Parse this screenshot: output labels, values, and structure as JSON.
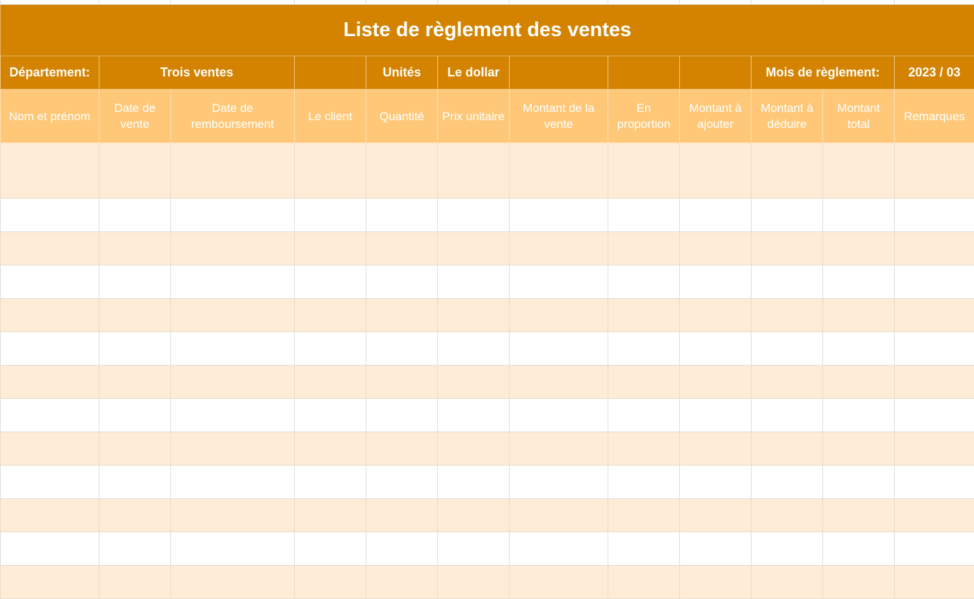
{
  "sheet": {
    "title": "Liste de règlement des ventes",
    "info": {
      "department_label": "Département:",
      "department_value": "Trois ventes",
      "units_label": "Unités",
      "units_value": "Le dollar",
      "month_label": "Mois de règlement:",
      "month_value": "2023 / 03"
    },
    "columns": [
      "Nom et prénom",
      "Date de vente",
      "Date de remboursement",
      "Le client",
      "Quantité",
      "Prix unitaire",
      "Montant de la vente",
      "En proportion",
      "Montant à ajouter",
      "Montant à déduire",
      "Montant total",
      "Remarques"
    ],
    "colors": {
      "title_bg": "#d38300",
      "header_bg": "#ffc878",
      "row_shade": "#ffecd6",
      "row_plain": "#ffffff",
      "text_light": "#ffffff"
    }
  }
}
